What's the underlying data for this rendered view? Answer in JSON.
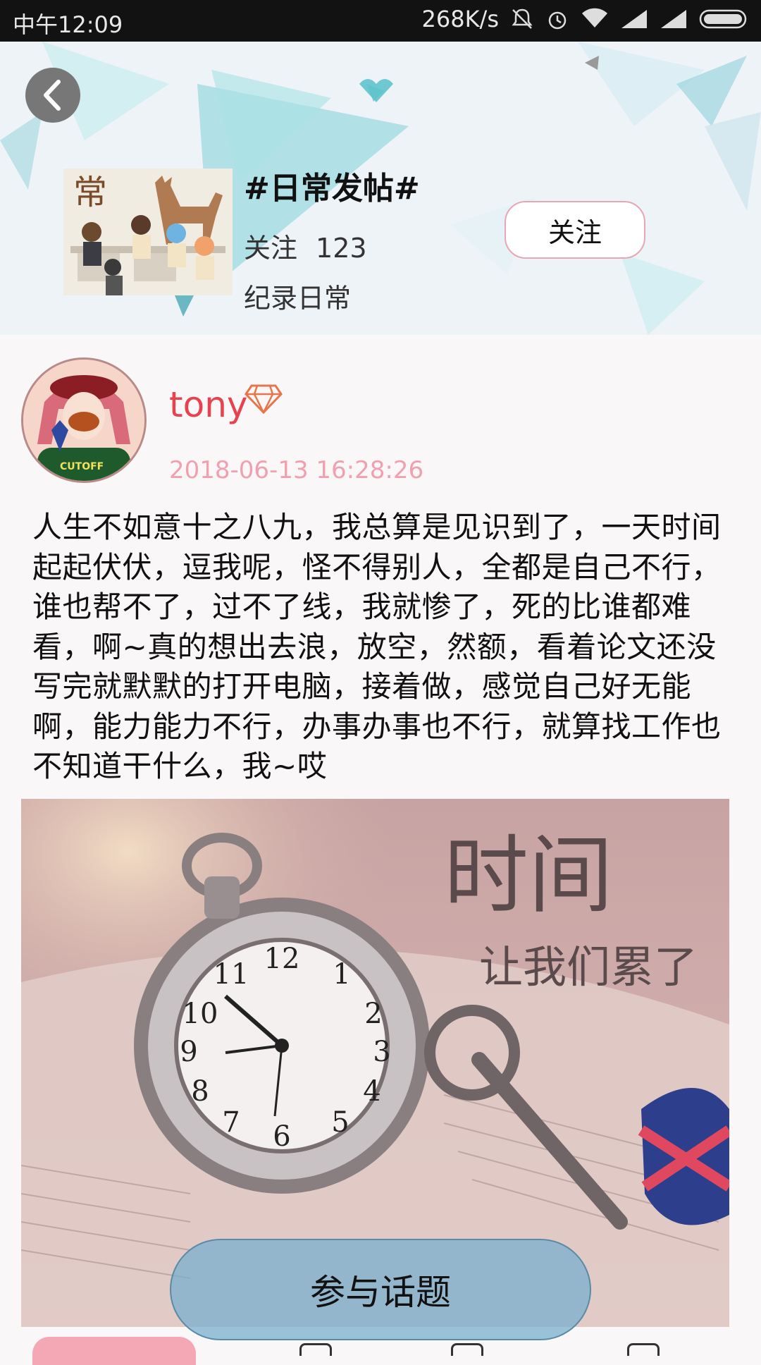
{
  "status_bar": {
    "time": "中午12:09",
    "speed": "268K/s"
  },
  "topic": {
    "title": "#日常发帖#",
    "follow_label": "关注",
    "follow_count": "123",
    "description": "纪录日常",
    "follow_button": "关注"
  },
  "post": {
    "username": "tony",
    "date": "2018-06-13 16:28:26",
    "text": "人生不如意十之八九，我总算是见识到了，一天时间起起伏伏，逗我呢，怪不得别人，全都是自己不行，谁也帮不了，过不了线，我就惨了，死的比谁都难看，啊~真的想出去浪，放空，然额，看着论文还没写完就默默的打开电脑，接着做，感觉自己好无能啊，能力能力不行，办事办事也不行，就算找工作也不知道干什么，我~哎",
    "image_caption_line1": "时间",
    "image_caption_line2": "让我们累了"
  },
  "join_button": "参与话题",
  "colors": {
    "accent_pink": "#f4a8b6",
    "username_red": "#e8424f",
    "date_pink": "#f0a0ae"
  }
}
